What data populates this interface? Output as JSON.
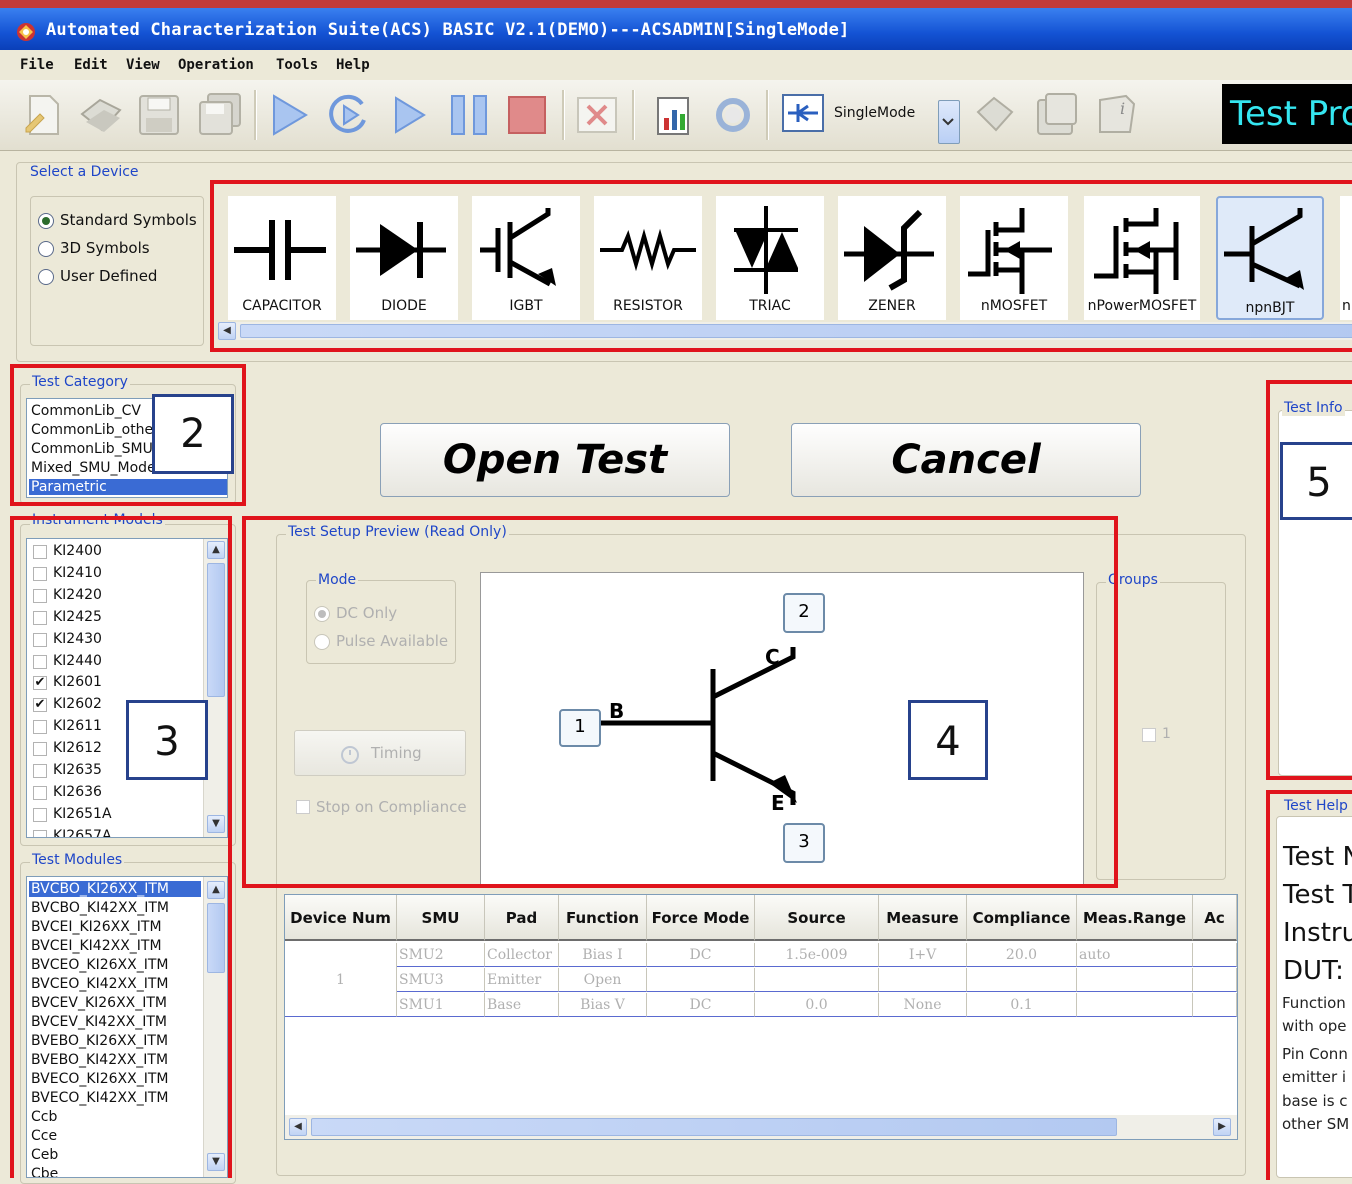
{
  "window": {
    "title": "Automated Characterization Suite(ACS) BASIC V2.1(DEMO)---ACSADMIN[SingleMode]"
  },
  "menu": {
    "file": "File",
    "edit": "Edit",
    "view": "View",
    "operation": "Operation",
    "tools": "Tools",
    "help": "Help"
  },
  "toolbar": {
    "mode_value": "SingleMode",
    "test_prog_label": "Test Pro"
  },
  "device_select": {
    "title": "Select a Device",
    "symbol_options": [
      {
        "label": "Standard Symbols",
        "selected": true
      },
      {
        "label": "3D Symbols",
        "selected": false
      },
      {
        "label": "User Defined",
        "selected": false
      }
    ],
    "devices": [
      "CAPACITOR",
      "DIODE",
      "IGBT",
      "RESISTOR",
      "TRIAC",
      "ZENER",
      "nMOSFET",
      "nPowerMOSFET",
      "npnBJT",
      "n"
    ],
    "selected_device": "npnBJT"
  },
  "test_category": {
    "title": "Test Category",
    "items": [
      "CommonLib_CV",
      "CommonLib_other",
      "CommonLib_SMU",
      "Mixed_SMU_Model",
      "Parametric"
    ],
    "selected": "Parametric"
  },
  "instrument_models": {
    "title": "Instrument Models",
    "items": [
      {
        "label": "KI2400",
        "checked": false
      },
      {
        "label": "KI2410",
        "checked": false
      },
      {
        "label": "KI2420",
        "checked": false
      },
      {
        "label": "KI2425",
        "checked": false
      },
      {
        "label": "KI2430",
        "checked": false
      },
      {
        "label": "KI2440",
        "checked": false
      },
      {
        "label": "KI2601",
        "checked": true
      },
      {
        "label": "KI2602",
        "checked": true
      },
      {
        "label": "KI2611",
        "checked": false
      },
      {
        "label": "KI2612",
        "checked": false
      },
      {
        "label": "KI2635",
        "checked": false
      },
      {
        "label": "KI2636",
        "checked": false
      },
      {
        "label": "KI2651A",
        "checked": false
      },
      {
        "label": "KI2657A",
        "checked": false
      }
    ]
  },
  "test_modules": {
    "title": "Test Modules",
    "items": [
      "BVCBO_KI26XX_ITM",
      "BVCBO_KI42XX_ITM",
      "BVCEI_KI26XX_ITM",
      "BVCEI_KI42XX_ITM",
      "BVCEO_KI26XX_ITM",
      "BVCEO_KI42XX_ITM",
      "BVCEV_KI26XX_ITM",
      "BVCEV_KI42XX_ITM",
      "BVEBO_KI26XX_ITM",
      "BVEBO_KI42XX_ITM",
      "BVECO_KI26XX_ITM",
      "BVECO_KI42XX_ITM",
      "Ccb",
      "Cce",
      "Ceb",
      "Cbe"
    ],
    "selected": "BVCBO_KI26XX_ITM"
  },
  "buttons": {
    "open_test": "Open Test",
    "cancel": "Cancel"
  },
  "preview": {
    "title": "Test Setup Preview (Read Only)",
    "mode_title": "Mode",
    "mode_options": [
      {
        "label": "DC Only",
        "selected": true
      },
      {
        "label": "Pulse Available",
        "selected": false
      }
    ],
    "timing_label": "Timing",
    "stop_on_compliance": "Stop on Compliance",
    "groups_title": "Groups",
    "groups_item": "1",
    "terminals": {
      "base_label": "B",
      "collector_label": "C",
      "emitter_label": "E",
      "base_pin": "1",
      "collector_pin": "2",
      "emitter_pin": "3"
    }
  },
  "smu_table": {
    "columns": [
      "Device Num",
      "SMU",
      "Pad",
      "Function",
      "Force Mode",
      "Source",
      "Measure",
      "Compliance",
      "Meas.Range",
      "Ac"
    ],
    "device_num": "1",
    "rows": [
      [
        "SMU2",
        "Collector",
        "Bias I",
        "DC",
        "1.5e-009",
        "I+V",
        "20.0",
        "auto",
        ""
      ],
      [
        "SMU3",
        "Emitter",
        "Open",
        "",
        "",
        "",
        "",
        "",
        ""
      ],
      [
        "SMU1",
        "Base",
        "Bias V",
        "DC",
        "0.0",
        "None",
        "0.1",
        "",
        ""
      ]
    ]
  },
  "test_info": {
    "title": "Test Info"
  },
  "test_help": {
    "title": "Test Help",
    "big_lines": [
      "Test N",
      "Test T",
      "Instru",
      "DUT:"
    ],
    "small_lines": [
      "Function",
      "with ope",
      "Pin Conn",
      "emitter i",
      "base is c",
      "other SM"
    ]
  },
  "callouts": [
    "2",
    "3",
    "4",
    "5"
  ],
  "colors": {
    "title_bar": "#1453d4",
    "highlight_red": "#e0141c",
    "group_label_blue": "#1f46c8",
    "selection_blue": "#3a6bd4",
    "callout_border": "#27428c"
  }
}
